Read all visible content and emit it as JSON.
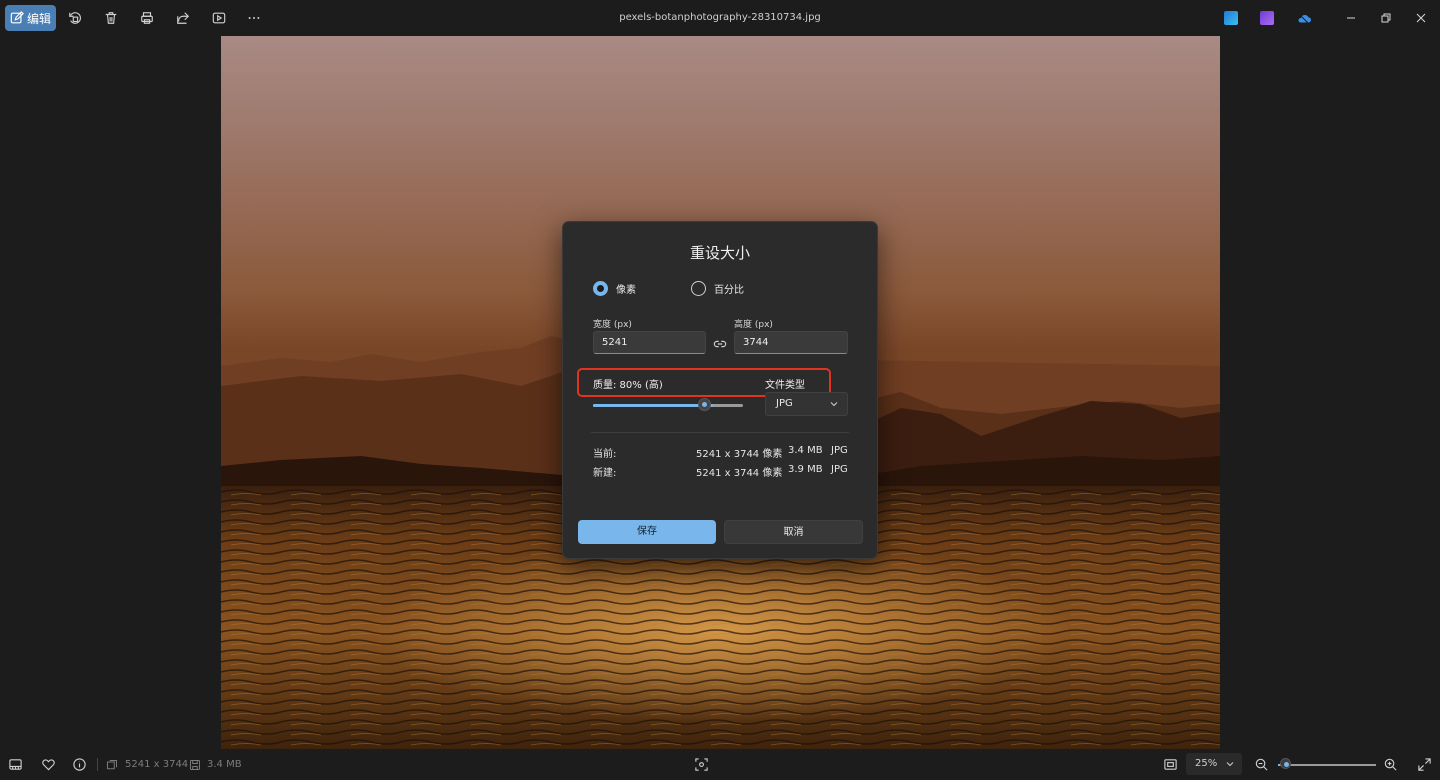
{
  "toolbar": {
    "edit_label": "编辑",
    "filename": "pexels-botanphotography-28310734.jpg",
    "icons": [
      "edit-icon",
      "rotate-icon",
      "delete-icon",
      "print-icon",
      "share-icon",
      "slideshow-icon",
      "more-icon"
    ],
    "app_icons": [
      "clipchamp-icon",
      "video-editor-icon",
      "onedrive-icon"
    ],
    "window_controls": [
      "minimize-icon",
      "restore-icon",
      "close-icon"
    ]
  },
  "dialog": {
    "title": "重设大小",
    "radio_pixels": "像素",
    "radio_percent": "百分比",
    "selected_mode": "pixels",
    "width_label": "宽度 (px)",
    "width_value": "5241",
    "height_label": "高度 (px)",
    "height_value": "3744",
    "quality_label": "质量: 80% (高)",
    "quality_value": 0.8,
    "filetype_label": "文件类型",
    "filetype_value": "JPG",
    "current_label": "当前:",
    "current_dims": "5241 x 3744 像素",
    "current_size": "3.4 MB",
    "current_type": "JPG",
    "new_label": "新建:",
    "new_dims": "5241 x 3744 像素",
    "new_size": "3.9 MB",
    "new_type": "JPG",
    "save_label": "保存",
    "cancel_label": "取消"
  },
  "statusbar": {
    "dimensions": "5241 x 3744",
    "filesize": "3.4 MB",
    "zoom": "25%",
    "zoom_level": 0.08
  },
  "colors": {
    "accent": "#78b6ec",
    "highlight_border": "#e1341e",
    "edit_button": "#4a7fb6"
  }
}
